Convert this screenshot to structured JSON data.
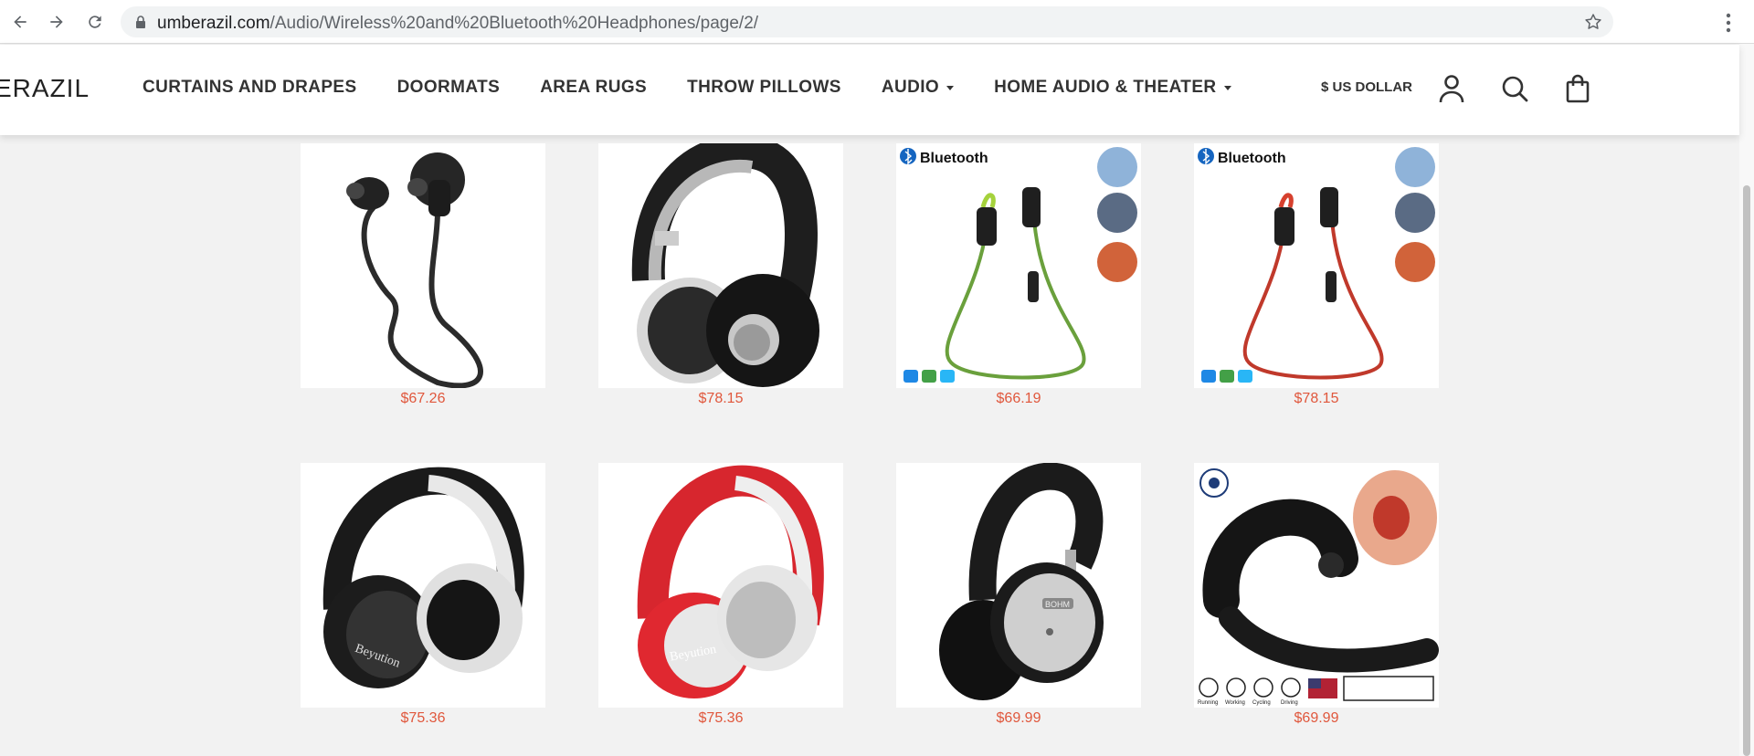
{
  "browser": {
    "url_domain": "umberazil.com",
    "url_path": "/Audio/Wireless%20and%20Bluetooth%20Headphones/page/2/"
  },
  "site": {
    "logo": "ERAZIL",
    "nav": [
      {
        "label": "CURTAINS AND DRAPES",
        "has_dropdown": false
      },
      {
        "label": "DOORMATS",
        "has_dropdown": false
      },
      {
        "label": "AREA RUGS",
        "has_dropdown": false
      },
      {
        "label": "THROW PILLOWS",
        "has_dropdown": false
      },
      {
        "label": "AUDIO",
        "has_dropdown": true
      },
      {
        "label": "HOME AUDIO & THEATER",
        "has_dropdown": true
      }
    ],
    "currency_label": "$ US DOLLAR",
    "icons": [
      "user-icon",
      "search-icon",
      "shopping-bag-icon"
    ]
  },
  "products": [
    {
      "price": "$67.26",
      "image": "black-neckband-earbuds"
    },
    {
      "price": "$78.15",
      "image": "black-grey-on-ear-headphones"
    },
    {
      "price": "$66.19",
      "image": "green-bluetooth-earbuds",
      "badge": "Bluetooth"
    },
    {
      "price": "$78.15",
      "image": "red-bluetooth-earbuds",
      "badge": "Bluetooth"
    },
    {
      "price": "$75.36",
      "image": "black-white-over-ear-headphones",
      "brand_text": "Beyution"
    },
    {
      "price": "$75.36",
      "image": "red-white-over-ear-headphones",
      "brand_text": "Beyution"
    },
    {
      "price": "$69.99",
      "image": "black-silver-headphones",
      "brand_text": "BOHM"
    },
    {
      "price": "$69.99",
      "image": "bone-conduction-headset",
      "small_labels": [
        "Running",
        "Working",
        "Cycling",
        "Driving"
      ]
    }
  ],
  "colors": {
    "price": "#e0573c",
    "nav_text": "#333333",
    "page_bg": "#f2f2f2"
  }
}
